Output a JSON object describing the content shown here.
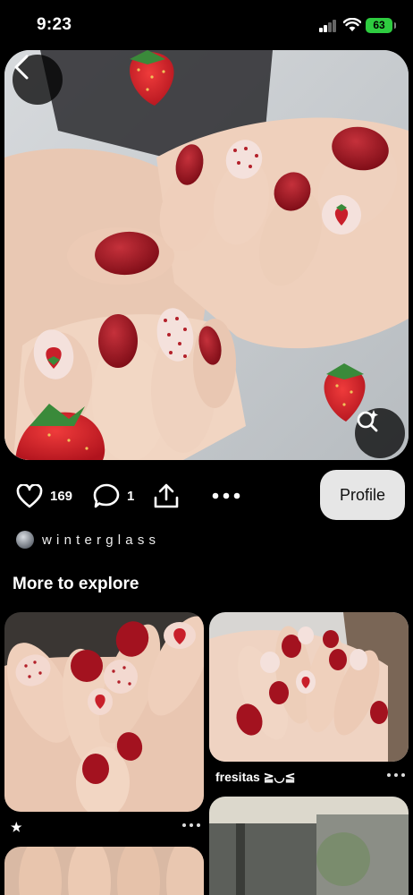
{
  "status_bar": {
    "time": "9:23",
    "battery": "63"
  },
  "pin": {
    "likes": "169",
    "comments": "1",
    "profile_label": "Profile",
    "author": "winterglass"
  },
  "section_title": "More to explore",
  "grid": [
    {
      "caption": "★"
    },
    {
      "caption": "fresitas ≧◡≦"
    }
  ],
  "colors": {
    "background": "#000000",
    "nail_red": "#a3121f",
    "strawberry": "#d9252f",
    "profile_button": "#e6e6e6",
    "battery": "#2ecc40"
  },
  "icons": [
    "back-icon",
    "visual-search-icon",
    "heart-icon",
    "comment-icon",
    "share-icon",
    "more-icon"
  ]
}
